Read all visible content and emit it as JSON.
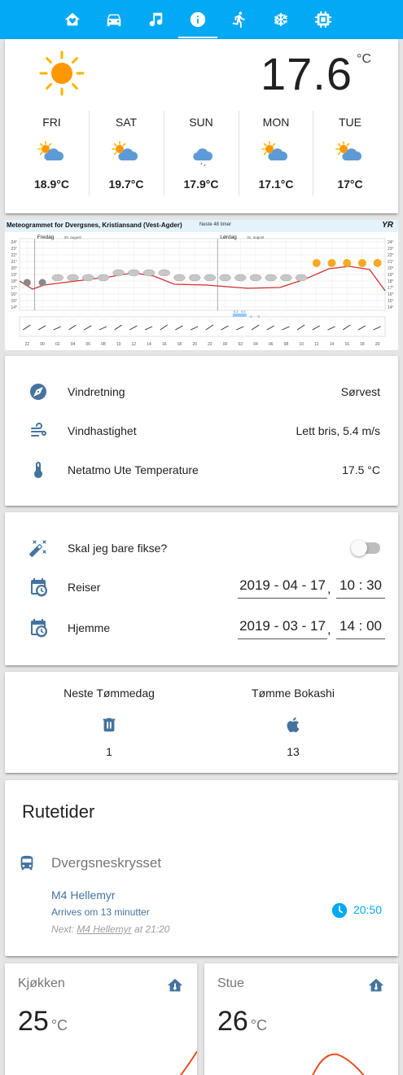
{
  "nav": {
    "tabs": [
      {
        "icon": "home-heart-icon"
      },
      {
        "icon": "car-icon"
      },
      {
        "icon": "music-note-icon"
      },
      {
        "icon": "information-icon",
        "active": true
      },
      {
        "icon": "run-icon"
      },
      {
        "icon": "snowflake-icon"
      },
      {
        "icon": "chip-icon"
      }
    ]
  },
  "weather": {
    "current_temp": "17.6",
    "unit": "°C",
    "forecast": [
      {
        "day": "FRI",
        "temp": "18.9°C",
        "icon": "partly-cloudy-icon"
      },
      {
        "day": "SAT",
        "temp": "19.7°C",
        "icon": "partly-cloudy-icon"
      },
      {
        "day": "SUN",
        "temp": "17.9°C",
        "icon": "rainy-cloud-icon"
      },
      {
        "day": "MON",
        "temp": "17.1°C",
        "icon": "partly-cloudy-icon"
      },
      {
        "day": "TUE",
        "temp": "17°C",
        "icon": "partly-cloudy-icon"
      }
    ]
  },
  "meteogram": {
    "title": "Meteogrammet for Dvergsnes, Kristiansand (Vest-Agder)",
    "subtitle": "Neste 48 timer",
    "logo": "YR",
    "day1": "Fredag",
    "day1_date": "30. august",
    "day2": "Lørdag",
    "day2_date": "31. august",
    "y_ticks": [
      "24°",
      "23°",
      "22°",
      "21°",
      "20°",
      "19°",
      "18°",
      "17°",
      "16°",
      "15°",
      "14°"
    ],
    "x_ticks": [
      "22",
      "00",
      "02",
      "04",
      "06",
      "08",
      "10",
      "12",
      "14",
      "16",
      "18",
      "20",
      "22",
      "00",
      "02",
      "04",
      "06",
      "08",
      "10",
      "12",
      "14",
      "16",
      "18",
      "20"
    ],
    "precip_labels": [
      "0.2",
      "0.1",
      "0",
      "0"
    ]
  },
  "entities": [
    {
      "name": "Vindretning",
      "value": "Sørvest",
      "icon": "compass-icon"
    },
    {
      "name": "Vindhastighet",
      "value": "Lett bris, 5.4 m/s",
      "icon": "weather-windy-icon"
    },
    {
      "name": "Netatmo Ute Temperature",
      "value": "17.5 °C",
      "icon": "thermometer-icon"
    }
  ],
  "controls": {
    "toggle_label": "Skal jeg bare fikse?",
    "reiser": {
      "label": "Reiser",
      "date": "2019 - 04 - 17",
      "time": "10 : 30"
    },
    "hjemme": {
      "label": "Hjemme",
      "date": "2019 - 03 - 17",
      "time": "14 : 00"
    },
    "comma": ","
  },
  "garbage": [
    {
      "label": "Neste Tømmedag",
      "value": "1",
      "icon": "trash-can-icon"
    },
    {
      "label": "Tømme Bokashi",
      "value": "13",
      "icon": "apple-icon"
    }
  ],
  "rutetider": {
    "title": "Rutetider",
    "stop": "Dvergsneskrysset",
    "line": "M4 Hellemyr",
    "arrives": "Arrives om 13 minutter",
    "next_prefix": "Next:",
    "next_line": "M4 Hellemyr",
    "next_suffix": "at 21:20",
    "time": "20:50"
  },
  "sensors": [
    {
      "name": "Kjøkken",
      "value": "25",
      "unit": "°C"
    },
    {
      "name": "Stue",
      "value": "26",
      "unit": "°C"
    }
  ],
  "colors": {
    "accent": "#03a9f4",
    "icon": "#44739e",
    "graph": "#d32f2f"
  }
}
